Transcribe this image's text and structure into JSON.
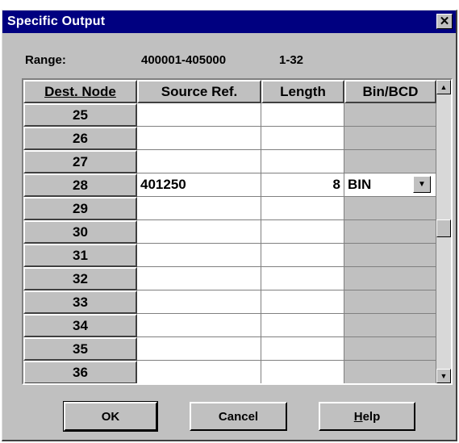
{
  "window": {
    "title": "Specific Output",
    "close_glyph": "✕"
  },
  "range": {
    "label": "Range:",
    "value": "400001-405000",
    "bits": "1-32"
  },
  "table": {
    "columns": [
      "Dest. Node",
      "Source Ref.",
      "Length",
      "Bin/BCD"
    ],
    "rows": [
      {
        "node": "25",
        "source": "",
        "length": "",
        "format": ""
      },
      {
        "node": "26",
        "source": "",
        "length": "",
        "format": ""
      },
      {
        "node": "27",
        "source": "",
        "length": "",
        "format": ""
      },
      {
        "node": "28",
        "source": "401250",
        "length": "8",
        "format": "BIN"
      },
      {
        "node": "29",
        "source": "",
        "length": "",
        "format": ""
      },
      {
        "node": "30",
        "source": "",
        "length": "",
        "format": ""
      },
      {
        "node": "31",
        "source": "",
        "length": "",
        "format": ""
      },
      {
        "node": "32",
        "source": "",
        "length": "",
        "format": ""
      },
      {
        "node": "33",
        "source": "",
        "length": "",
        "format": ""
      },
      {
        "node": "34",
        "source": "",
        "length": "",
        "format": ""
      },
      {
        "node": "35",
        "source": "",
        "length": "",
        "format": ""
      },
      {
        "node": "36",
        "source": "",
        "length": "",
        "format": ""
      }
    ],
    "active_row_index": 3,
    "dropdown_icon": "dropdown-arrow-icon"
  },
  "scrollbar": {
    "up_icon": "scroll-up-arrow-icon",
    "down_icon": "scroll-down-arrow-icon",
    "position_fraction": 0.5
  },
  "buttons": {
    "ok": "OK",
    "cancel": "Cancel",
    "help_first": "H",
    "help_rest": "elp"
  },
  "colors": {
    "titlebar": "#000080",
    "face": "#c0c0c0",
    "cell": "#ffffff"
  }
}
